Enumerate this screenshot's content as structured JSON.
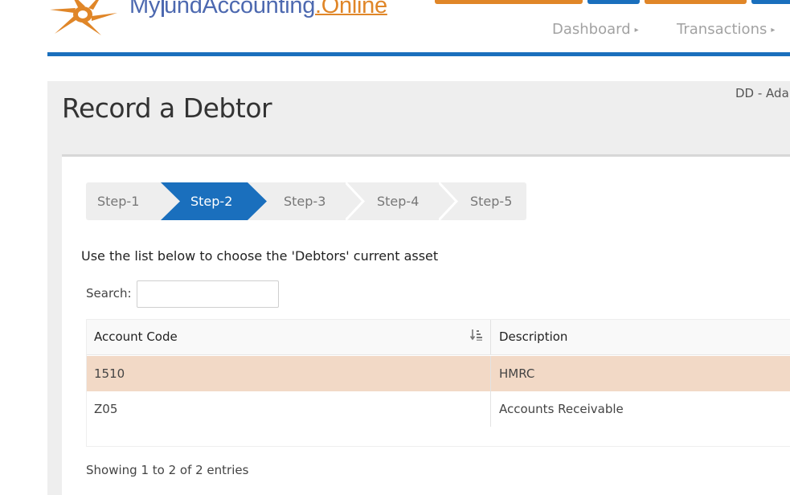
{
  "header": {
    "brand": {
      "part1": "My",
      "part2": "undAccounting",
      "part3": ".Online"
    },
    "nav": [
      {
        "label": "Dashboard"
      },
      {
        "label": "Transactions"
      }
    ]
  },
  "page": {
    "title": "Record a Debtor",
    "user": "DD - Ada"
  },
  "steps": [
    {
      "label": "Step-1",
      "active": false
    },
    {
      "label": "Step-2",
      "active": true
    },
    {
      "label": "Step-3",
      "active": false
    },
    {
      "label": "Step-4",
      "active": false
    },
    {
      "label": "Step-5",
      "active": false
    }
  ],
  "instruction": "Use the list below to choose the 'Debtors' current asset",
  "search": {
    "label": "Search:",
    "value": ""
  },
  "table": {
    "columns": [
      "Account Code",
      "Description"
    ],
    "rows": [
      {
        "code": "1510",
        "description": "HMRC",
        "selected": true
      },
      {
        "code": "Z05",
        "description": "Accounts Receivable",
        "selected": false
      }
    ],
    "info": "Showing 1 to 2 of 2 entries"
  },
  "colors": {
    "accent_blue": "#1a6fbd",
    "accent_orange": "#e08628",
    "selected_row": "#f2d9c6"
  }
}
